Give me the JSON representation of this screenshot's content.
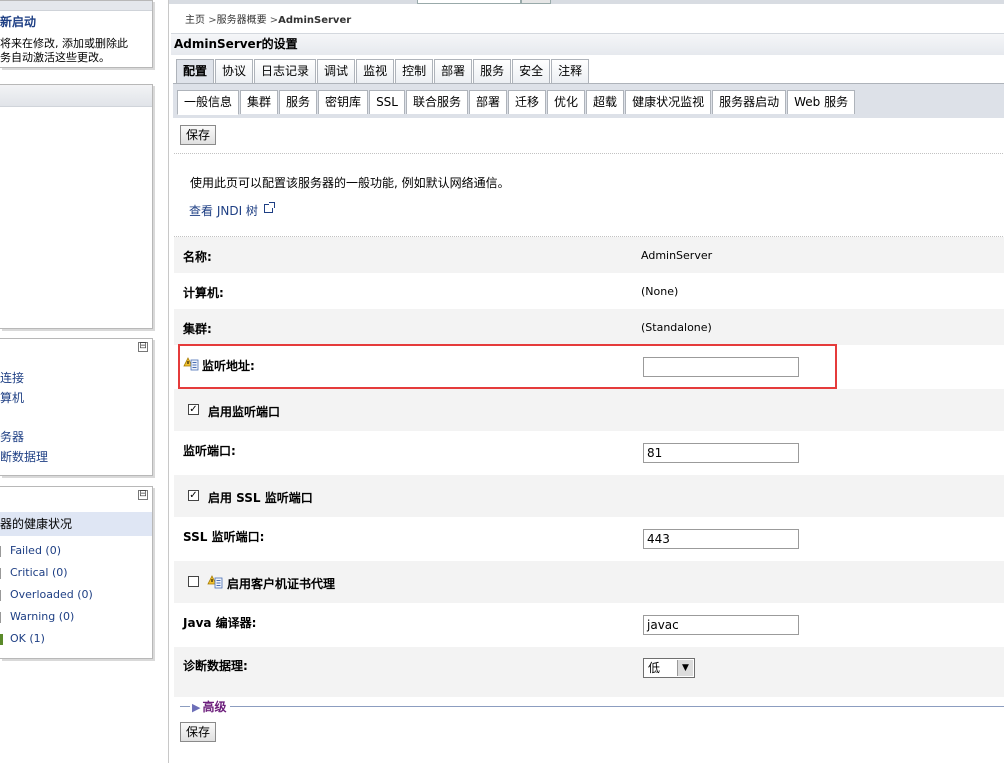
{
  "left": {
    "panel1": {
      "title": "新启动",
      "text": "将来在修改, 添加或删除此\n务自动激活这些更改。"
    },
    "panel3": {
      "links": [
        "连接",
        "算机",
        "务器",
        "断数据理"
      ]
    },
    "panel4": {
      "title": "器的健康状况",
      "items": [
        {
          "label": "Failed (0)",
          "color": "#ffffff"
        },
        {
          "label": "Critical (0)",
          "color": "#ffffff"
        },
        {
          "label": "Overloaded (0)",
          "color": "#ffffff"
        },
        {
          "label": "Warning (0)",
          "color": "#ffffff"
        },
        {
          "label": "OK (1)",
          "color": "#5a8a2a"
        }
      ]
    },
    "collapse_glyph": "⊟"
  },
  "breadcrumb": {
    "home": "主页",
    "sep1": ">",
    "summary": "服务器概要",
    "sep2": ">",
    "current": "AdminServer"
  },
  "page_title": "AdminServer的设置",
  "tabs_primary": [
    "配置",
    "协议",
    "日志记录",
    "调试",
    "监视",
    "控制",
    "部署",
    "服务",
    "安全",
    "注释"
  ],
  "tabs_secondary": [
    "一般信息",
    "集群",
    "服务",
    "密钥库",
    "SSL",
    "联合服务",
    "部署",
    "迁移",
    "优化",
    "超载",
    "健康状况监视",
    "服务器启动",
    "Web 服务"
  ],
  "save_label": "保存",
  "description": "使用此页可以配置该服务器的一般功能, 例如默认网络通信。",
  "jndi_link": "查看 JNDI 树",
  "fields": {
    "name_label": "名称:",
    "name_value": "AdminServer",
    "machine_label": "计算机:",
    "machine_value": "(None)",
    "cluster_label": "集群:",
    "cluster_value": "(Standalone)",
    "listen_address_label": "监听地址:",
    "listen_address_value": "",
    "listen_port_enabled_label": "启用监听端口",
    "listen_port_label": "监听端口:",
    "listen_port_value": "81",
    "ssl_enabled_label": "启用  SSL 监听端口",
    "ssl_port_label": "SSL 监听端口:",
    "ssl_port_value": "443",
    "client_cert_proxy_label": "启用客户机证书代理",
    "java_compiler_label": "Java 编译器:",
    "java_compiler_value": "javac",
    "diag_volume_label": "诊断数据理:",
    "diag_volume_value": "低"
  },
  "advanced_label": "高级",
  "colors": {
    "accent": "#1e3f84",
    "highlight_border": "#e53b3b",
    "advanced": "#6d1f7c"
  }
}
